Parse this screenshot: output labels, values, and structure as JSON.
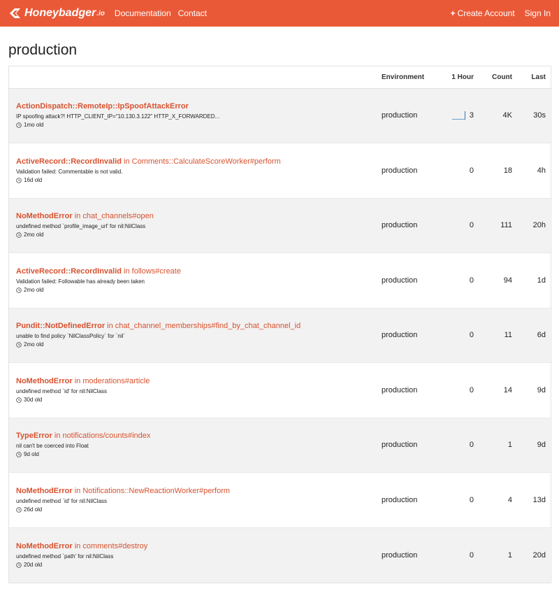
{
  "brand": {
    "name": "Honeybadger",
    "suffix": ".io"
  },
  "nav": {
    "documentation": "Documentation",
    "contact": "Contact",
    "create_account": "Create Account",
    "sign_in": "Sign In"
  },
  "page": {
    "title": "production"
  },
  "table": {
    "headers": {
      "error": "",
      "environment": "Environment",
      "hour": "1 Hour",
      "count": "Count",
      "last": "Last"
    },
    "rows": [
      {
        "error_class": "ActionDispatch::RemoteIp::IpSpoofAttackError",
        "location": "",
        "message": "IP spoofing attack?! HTTP_CLIENT_IP=\"10.130.3.122\" HTTP_X_FORWARDED...",
        "age": "1mo old",
        "environment": "production",
        "hour": "3",
        "count": "4K",
        "last": "30s"
      },
      {
        "error_class": "ActiveRecord::RecordInvalid",
        "location": "in Comments::CalculateScoreWorker#perform",
        "message": "Validation failed: Commentable is not valid.",
        "age": "16d old",
        "environment": "production",
        "hour": "0",
        "count": "18",
        "last": "4h"
      },
      {
        "error_class": "NoMethodError",
        "location": "in chat_channels#open",
        "message": "undefined method `profile_image_url' for nil:NilClass",
        "age": "2mo old",
        "environment": "production",
        "hour": "0",
        "count": "111",
        "last": "20h"
      },
      {
        "error_class": "ActiveRecord::RecordInvalid",
        "location": "in follows#create",
        "message": "Validation failed: Followable has already been taken",
        "age": "2mo old",
        "environment": "production",
        "hour": "0",
        "count": "94",
        "last": "1d"
      },
      {
        "error_class": "Pundit::NotDefinedError",
        "location": "in chat_channel_memberships#find_by_chat_channel_id",
        "message": "unable to find policy `NilClassPolicy` for `nil`",
        "age": "2mo old",
        "environment": "production",
        "hour": "0",
        "count": "11",
        "last": "6d"
      },
      {
        "error_class": "NoMethodError",
        "location": "in moderations#article",
        "message": "undefined method `id' for nil:NilClass",
        "age": "30d old",
        "environment": "production",
        "hour": "0",
        "count": "14",
        "last": "9d"
      },
      {
        "error_class": "TypeError",
        "location": "in notifications/counts#index",
        "message": "nil can't be coerced into Float",
        "age": "9d old",
        "environment": "production",
        "hour": "0",
        "count": "1",
        "last": "9d"
      },
      {
        "error_class": "NoMethodError",
        "location": "in Notifications::NewReactionWorker#perform",
        "message": "undefined method `id' for nil:NilClass",
        "age": "26d old",
        "environment": "production",
        "hour": "0",
        "count": "4",
        "last": "13d"
      },
      {
        "error_class": "NoMethodError",
        "location": "in comments#destroy",
        "message": "undefined method `path' for nil:NilClass",
        "age": "20d old",
        "environment": "production",
        "hour": "0",
        "count": "1",
        "last": "20d"
      }
    ]
  },
  "colors": {
    "brand": "#ea5937",
    "error_link": "#d8512f",
    "sparkline": "#3173b2",
    "row_alt": "#f2f2f2"
  },
  "icons": {
    "logo": "honeybadger-logo-icon",
    "plus": "plus-icon",
    "clock": "clock-icon",
    "sparkline": "sparkline-icon"
  }
}
